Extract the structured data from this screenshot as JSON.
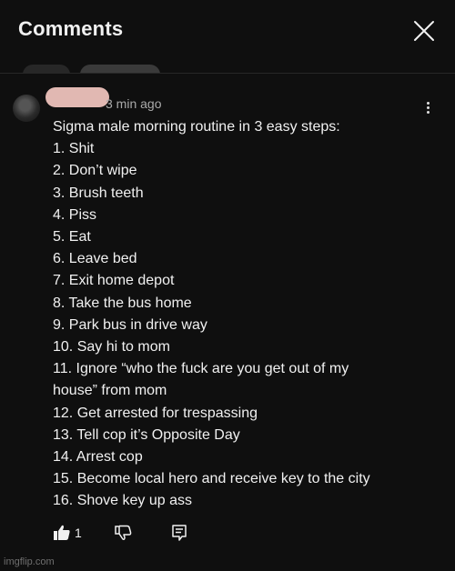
{
  "header": {
    "title": "Comments"
  },
  "comment": {
    "timestamp": "3 min ago",
    "lines": [
      "Sigma male morning routine in 3 easy steps:",
      "1. Shit",
      "2. Don’t wipe",
      "3. Brush teeth",
      "4. Piss",
      "5. Eat",
      "6. Leave bed",
      "7. Exit home depot",
      "8. Take the bus home",
      "9. Park bus in drive way",
      "10. Say hi to mom",
      "11. Ignore “who the fuck are you get out of my",
      "house” from mom",
      "12. Get arrested for trespassing",
      "13. Tell cop it’s Opposite Day",
      "14. Arrest cop",
      "15. Become local hero and receive key to the city",
      "16. Shove key up ass"
    ],
    "like_count": "1"
  },
  "icons": {
    "close": "close-icon",
    "more": "more-vert-icon",
    "like": "thumb-up-icon",
    "dislike": "thumb-down-icon",
    "reply": "reply-icon"
  },
  "watermark": "imgflip.com",
  "colors": {
    "background": "#0f0f0f",
    "text": "#f1f1f1",
    "secondary": "#aaaaaa"
  }
}
